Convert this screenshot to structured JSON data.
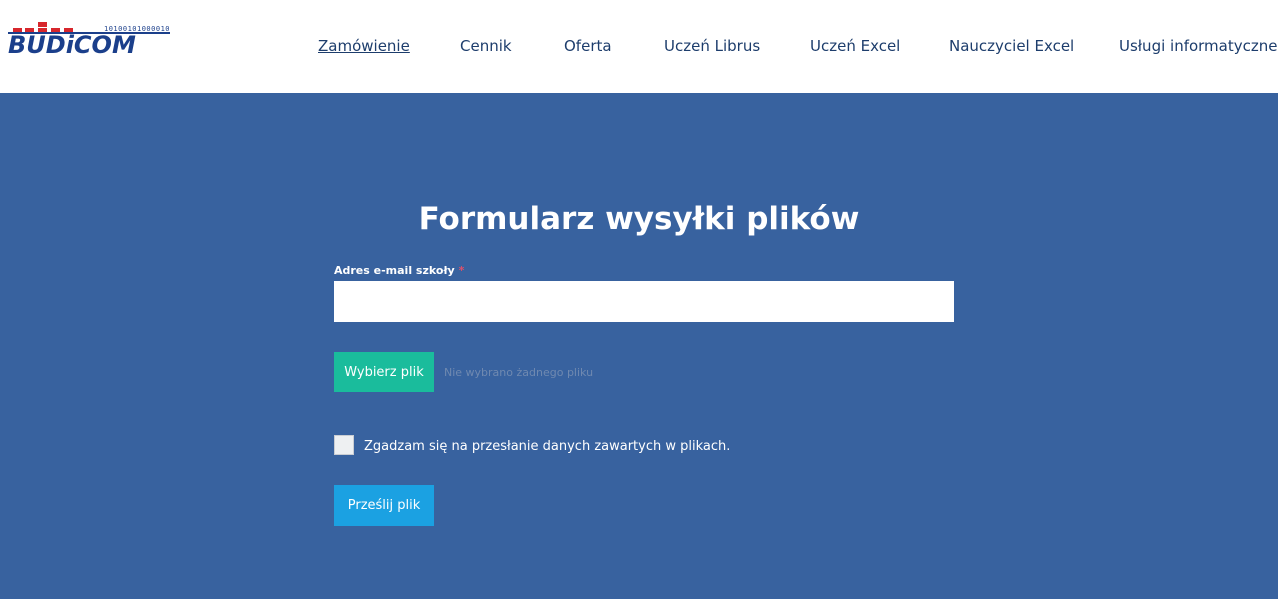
{
  "header": {
    "logo": {
      "text": "BUDiCOM",
      "bits": "10100101000010"
    },
    "nav": [
      {
        "label": "Zamówienie",
        "active": true
      },
      {
        "label": "Cennik",
        "active": false
      },
      {
        "label": "Oferta",
        "active": false
      },
      {
        "label": "Uczeń Librus",
        "active": false
      },
      {
        "label": "Uczeń Excel",
        "active": false
      },
      {
        "label": "Nauczyciel Excel",
        "active": false
      },
      {
        "label": "Usługi informatyczne",
        "active": false
      }
    ]
  },
  "form": {
    "title": "Formularz wysyłki plików",
    "email_label": "Adres e-mail szkoły",
    "required_mark": "*",
    "email_value": "",
    "file_button": "Wybierz plik",
    "file_status": "Nie wybrano żadnego pliku",
    "consent_label": "Zgadzam się na przesłanie danych zawartych w plikach.",
    "consent_checked": false,
    "submit_button": "Prześlij plik"
  },
  "colors": {
    "brand_blue": "#1b3f8b",
    "brand_red": "#d7262c",
    "main_bg": "#38629f",
    "file_button_bg": "#1abc9c",
    "submit_button_bg": "#1ba1e2",
    "nav_text": "#1d3d6c"
  }
}
